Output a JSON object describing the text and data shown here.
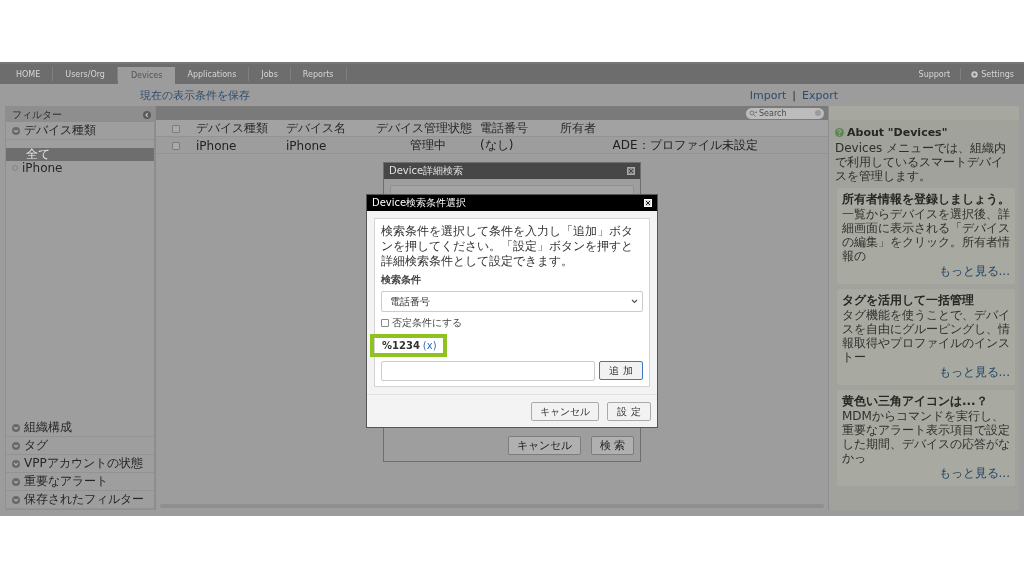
{
  "nav": {
    "tabs": [
      {
        "label": "HOME",
        "selected": false
      },
      {
        "label": "Users/Org",
        "selected": false
      },
      {
        "label": "Devices",
        "selected": true
      },
      {
        "label": "Applications",
        "selected": false
      },
      {
        "label": "Jobs",
        "selected": false
      },
      {
        "label": "Reports",
        "selected": false
      }
    ],
    "right_links": [
      {
        "label": "Support",
        "kind": "plain"
      },
      {
        "label": "Settings",
        "kind": "gear"
      }
    ]
  },
  "toolbar": {
    "save_link": "現在の表示条件を保存",
    "import_link": "Import",
    "separator": "|",
    "export_link": "Export"
  },
  "sidebar": {
    "title": "フィルター",
    "section": {
      "label": "デバイス種類",
      "items": [
        {
          "label": "全て",
          "selected": true
        },
        {
          "label": "iPhone",
          "selected": false
        }
      ]
    },
    "bottom_sections": [
      "組織構成",
      "タグ",
      "VPPアカウントの状態",
      "重要なアラート",
      "保存されたフィルター"
    ]
  },
  "table": {
    "search_placeholder": "Search",
    "header_checked": false,
    "columns": [
      "デバイス種類",
      "デバイス名",
      "デバイス管理状態",
      "電話番号",
      "所有者"
    ],
    "rows": [
      {
        "checked": false,
        "cells": [
          "iPhone",
          "iPhone",
          "管理中",
          "(なし)",
          "ADE：プロファイル未設定"
        ]
      }
    ]
  },
  "info_panel": {
    "title": "About \"Devices\"",
    "intro": "Devices メニューでは、組織内で利用しているスマートデバイスを管理します。",
    "cards": [
      {
        "title": "所有者情報を登録しましょう。",
        "text": "一覧からデバイスを選択後、詳細画面に表示される「デバイスの編集」をクリック。所有者情報の",
        "more": "もっと見る..."
      },
      {
        "title": "タグを活用して一括管理",
        "text": "タグ機能を使うことで、デバイスを自由にグルーピングし、情報取得やプロファイルのインストー",
        "more": "もっと見る..."
      },
      {
        "title": "黄色い三角アイコンは...？",
        "text": "MDMからコマンドを実行し、重要なアラート表示項目で設定した期間、デバイスの応答がなかっ",
        "more": "もっと見る..."
      }
    ]
  },
  "search_dialog": {
    "title": "Device詳細検索",
    "buttons": [
      "キャンセル",
      "検 索"
    ]
  },
  "condition_dialog": {
    "title": "Device検索条件選択",
    "description": "検索条件を選択して条件を入力し「追加」ボタンを押してください。「設定」ボタンを押すと詳細検索条件として設定できます。",
    "field_label": "検索条件",
    "select_value": "電話番号",
    "negate": {
      "label": "否定条件にする",
      "checked": false
    },
    "condition": {
      "value": "%1234",
      "remove": "(x)",
      "highlighted": true
    },
    "add_button": "追 加",
    "buttons": [
      "キャンセル",
      "設 定"
    ]
  }
}
